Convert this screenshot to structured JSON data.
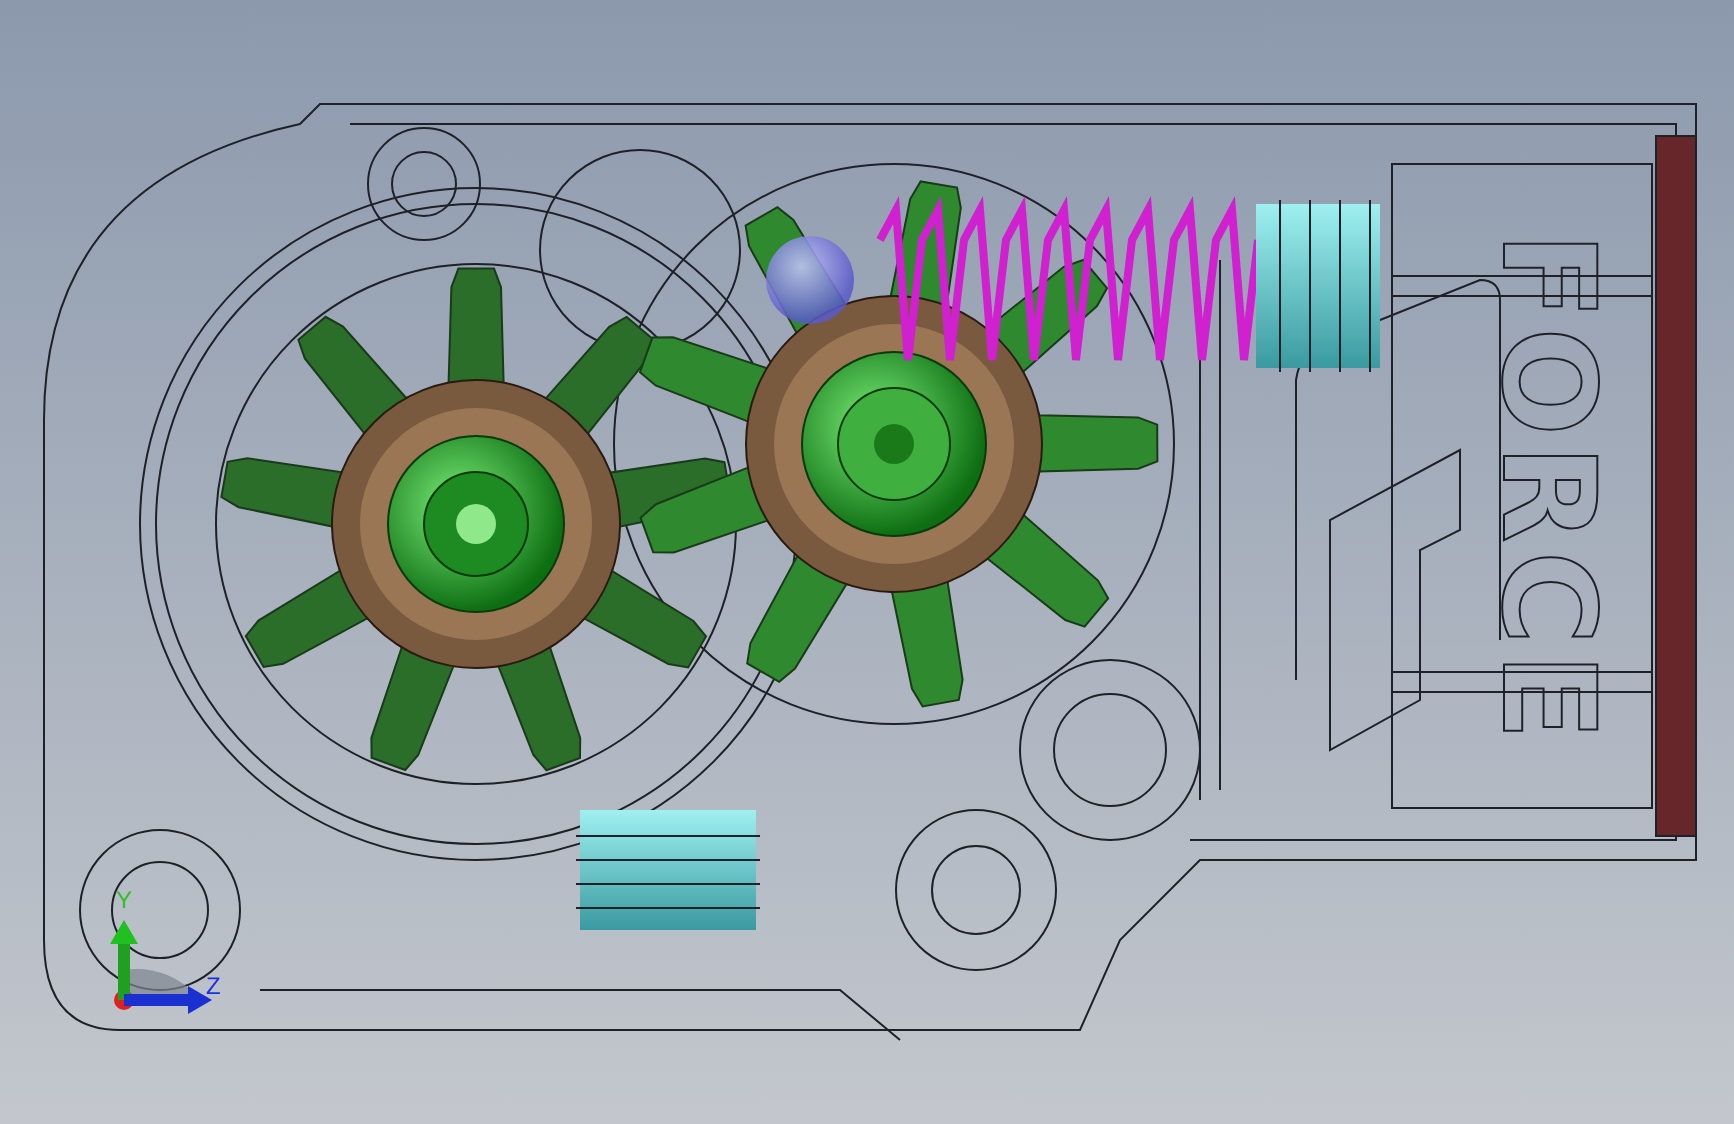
{
  "viewport": {
    "engraving": "FORCE",
    "triad": {
      "y_label": "Y",
      "z_label": "Z"
    }
  }
}
